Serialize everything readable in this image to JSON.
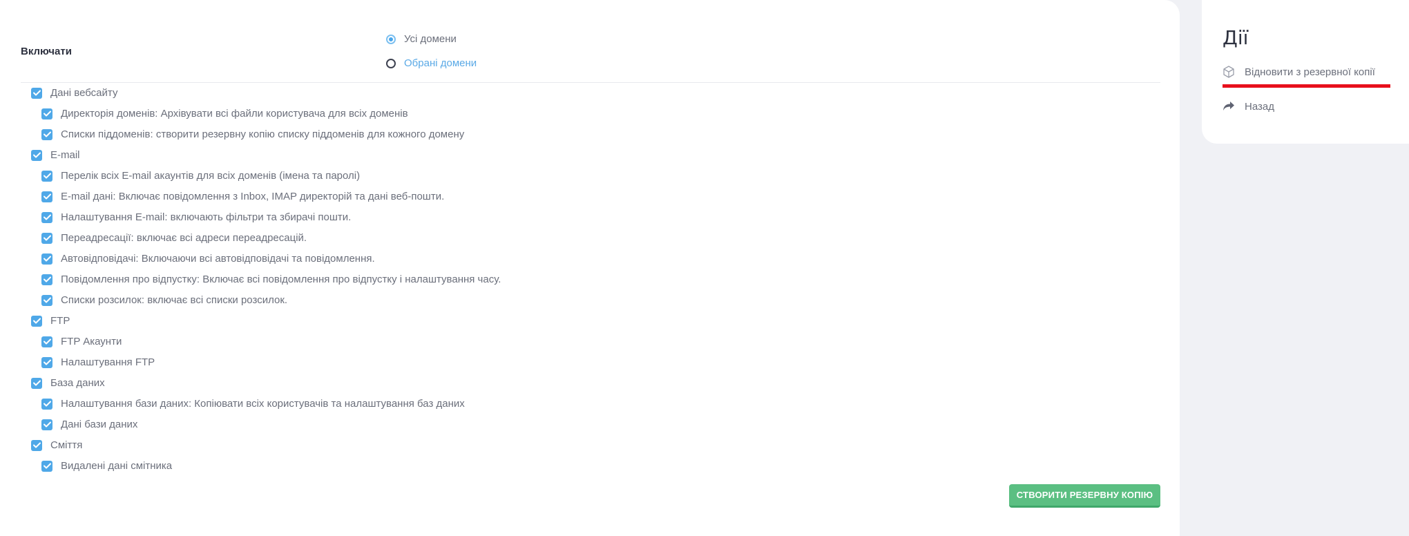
{
  "form": {
    "include_label": "Включати",
    "radio_all": "Усі домени",
    "radio_selected": "Обрані домени",
    "selected_scope": "all"
  },
  "options": [
    {
      "label": "Дані вебсайту",
      "level": 0,
      "checked": true
    },
    {
      "label": "Директорія доменів: Архівувати всі файли користувача для всіх доменів",
      "level": 1,
      "checked": true
    },
    {
      "label": "Списки піддоменів: створити резервну копію списку піддоменів для кожного домену",
      "level": 1,
      "checked": true
    },
    {
      "label": "E-mail",
      "level": 0,
      "checked": true
    },
    {
      "label": "Перелік всіх E-mail акаунтів для всіх доменів (імена та паролі)",
      "level": 1,
      "checked": true
    },
    {
      "label": "E-mail дані: Включає повідомлення з Inbox, IMAP директорій та дані веб-пошти.",
      "level": 1,
      "checked": true
    },
    {
      "label": "Налаштування E-mail: включають фільтри та збирачі пошти.",
      "level": 1,
      "checked": true
    },
    {
      "label": "Переадресації: включає всі адреси переадресацій.",
      "level": 1,
      "checked": true
    },
    {
      "label": "Автовідповідачі: Включаючи всі автовідповідачі та повідомлення.",
      "level": 1,
      "checked": true
    },
    {
      "label": "Повідомлення про відпустку: Включає всі повідомлення про відпустку і налаштування часу.",
      "level": 1,
      "checked": true
    },
    {
      "label": "Списки розсилок: включає всі списки розсилок.",
      "level": 1,
      "checked": true
    },
    {
      "label": "FTP",
      "level": 0,
      "checked": true
    },
    {
      "label": "FTP Акаунти",
      "level": 1,
      "checked": true
    },
    {
      "label": "Налаштування FTP",
      "level": 1,
      "checked": true
    },
    {
      "label": "База даних",
      "level": 0,
      "checked": true
    },
    {
      "label": "Налаштування бази даних: Копіювати всіх користувачів та налаштування баз даних",
      "level": 1,
      "checked": true
    },
    {
      "label": "Дані бази даних",
      "level": 1,
      "checked": true
    },
    {
      "label": "Сміття",
      "level": 0,
      "checked": true
    },
    {
      "label": "Видалені дані смітника",
      "level": 1,
      "checked": true
    }
  ],
  "actions": {
    "create_button": "СТВОРИТИ РЕЗЕРВНУ КОПІЮ"
  },
  "sidebar": {
    "title": "Дії",
    "items": [
      {
        "label": "Відновити з резервної копії",
        "icon": "box-icon",
        "highlighted": true
      },
      {
        "label": "Назад",
        "icon": "share-arrow-icon"
      }
    ]
  },
  "colors": {
    "accent_blue": "#4fa8e8",
    "button_green": "#5bbf82",
    "highlight_red": "#e8101c"
  }
}
